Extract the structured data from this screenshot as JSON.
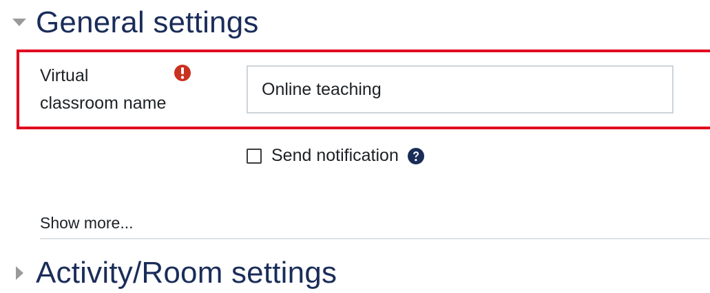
{
  "sections": {
    "general": {
      "title": "General settings",
      "expanded": true,
      "toggle_icon": "triangle-down-icon"
    },
    "activity": {
      "title": "Activity/Room settings",
      "expanded": false,
      "toggle_icon": "triangle-right-icon"
    }
  },
  "form": {
    "name_field": {
      "label_line1": "Virtual",
      "label_line2": "classroom name",
      "value": "Online teaching",
      "required_icon": "exclamation-circle-icon"
    },
    "notification": {
      "label": "Send notification",
      "checked": false,
      "help_icon": "question-circle-icon"
    },
    "show_more": "Show more..."
  },
  "colors": {
    "heading": "#1a2d59",
    "highlight_border": "#e1001e",
    "required_icon": "#ca3120",
    "help_icon": "#1a2d59",
    "input_border": "#ced4da"
  }
}
